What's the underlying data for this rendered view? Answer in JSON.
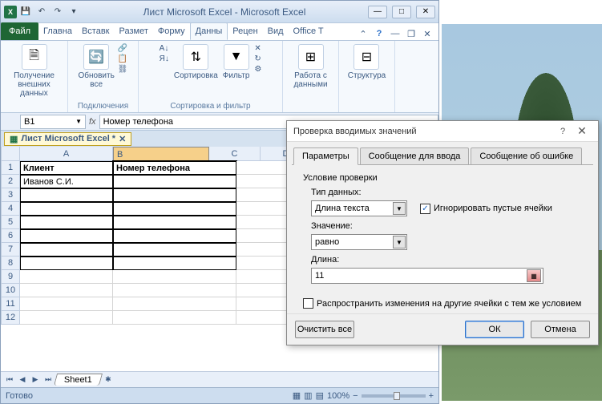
{
  "titlebar": {
    "title": "Лист Microsoft Excel  -  Microsoft Excel"
  },
  "tabs": {
    "file": "Файл",
    "items": [
      "Главна",
      "Вставк",
      "Размет",
      "Форму",
      "Данны",
      "Рецен",
      "Вид",
      "Office T"
    ],
    "active_index": 4
  },
  "ribbon": {
    "group1": {
      "label": "Получение\nвнешних данных",
      "group_label": ""
    },
    "group2": {
      "refresh": "Обновить\nвсе",
      "group_label": "Подключения"
    },
    "group3": {
      "sort_small_az": "А↓",
      "sort_small_za": "Я↓",
      "sort": "Сортировка",
      "filter": "Фильтр",
      "group_label": "Сортировка и фильтр"
    },
    "group4": {
      "data_tools": "Работа с\nданными"
    },
    "group5": {
      "outline": "Структура"
    }
  },
  "formula_bar": {
    "namebox": "B1",
    "formula": "Номер телефона",
    "fx": "fx"
  },
  "workbook_tab": "Лист Microsoft Excel *",
  "grid": {
    "columns": [
      "A",
      "B",
      "C",
      "D"
    ],
    "selected_col": "B",
    "rows": [
      {
        "num": "1",
        "A": "Клиент",
        "B": "Номер телефона"
      },
      {
        "num": "2",
        "A": "Иванов С.И.",
        "B": ""
      },
      {
        "num": "3",
        "A": "",
        "B": ""
      },
      {
        "num": "4",
        "A": "",
        "B": ""
      },
      {
        "num": "5",
        "A": "",
        "B": ""
      },
      {
        "num": "6",
        "A": "",
        "B": ""
      },
      {
        "num": "7",
        "A": "",
        "B": ""
      },
      {
        "num": "8",
        "A": "",
        "B": ""
      },
      {
        "num": "9",
        "A": "",
        "B": ""
      },
      {
        "num": "10",
        "A": "",
        "B": ""
      },
      {
        "num": "11",
        "A": "",
        "B": ""
      },
      {
        "num": "12",
        "A": "",
        "B": ""
      }
    ]
  },
  "sheet_tab": "Sheet1",
  "statusbar": {
    "status": "Готово",
    "zoom": "100%"
  },
  "dialog": {
    "title": "Проверка вводимых значений",
    "tabs": [
      "Параметры",
      "Сообщение для ввода",
      "Сообщение об ошибке"
    ],
    "active_tab": 0,
    "section_label": "Условие проверки",
    "type_label": "Тип данных:",
    "type_value": "Длина текста",
    "ignore_blank_label": "Игнорировать пустые ячейки",
    "ignore_blank_checked": true,
    "operator_label": "Значение:",
    "operator_value": "равно",
    "length_label": "Длина:",
    "length_value": "11",
    "apply_label": "Распространить изменения на другие ячейки с тем же условием",
    "apply_checked": false,
    "clear_btn": "Очистить все",
    "ok_btn": "ОК",
    "cancel_btn": "Отмена"
  }
}
